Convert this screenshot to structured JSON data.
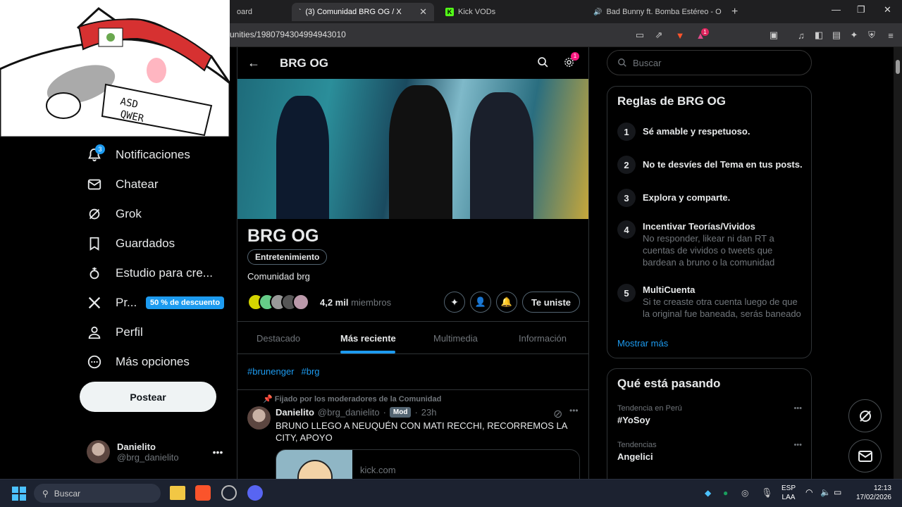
{
  "browser": {
    "tabs": [
      {
        "label": "oard",
        "active": false
      },
      {
        "label": "(3) Comunidad BRG OG / X",
        "active": true
      },
      {
        "label": "Kick VODs",
        "active": false
      },
      {
        "label": "Bad Bunny ft. Bomba Estéreo - O",
        "active": false
      }
    ],
    "url": "unities/1980794304994943010",
    "badge_count": "1"
  },
  "sidebar": {
    "notif_badge": "3",
    "items": [
      {
        "label": "Notificaciones",
        "icon": "bell-icon"
      },
      {
        "label": "Chatear",
        "icon": "mail-icon"
      },
      {
        "label": "Grok",
        "icon": "grok-icon"
      },
      {
        "label": "Guardados",
        "icon": "bookmark-icon"
      },
      {
        "label": "Estudio para cre...",
        "icon": "studio-icon"
      },
      {
        "label": "Pr...",
        "icon": "x-logo-icon"
      },
      {
        "label": "Perfil",
        "icon": "person-icon"
      },
      {
        "label": "Más opciones",
        "icon": "more-circle-icon"
      }
    ],
    "discount": "50 % de descuento",
    "post_label": "Postear",
    "user_name": "Danielito",
    "user_handle": "@brg_danielito"
  },
  "header": {
    "title": "BRG OG",
    "settings_badge": "1"
  },
  "community": {
    "name": "BRG OG",
    "category": "Entretenimiento",
    "description": "Comunidad brg",
    "members_count": "4,2 mil",
    "members_label": "miembros",
    "joined_label": "Te uniste"
  },
  "tabs": [
    "Destacado",
    "Más reciente",
    "Multimedia",
    "Información"
  ],
  "active_tab": 1,
  "hashtags": [
    "#brunenger",
    "#brg"
  ],
  "post": {
    "pinned_label": "Fijado por los moderadores de la Comunidad",
    "author": "Danielito",
    "handle": "@brg_danielito",
    "mod_badge": "Mod",
    "time": "23h",
    "text": "BRUNO LLEGO A NEUQUÉN CON MATI RECCHI, RECORREMOS LA CITY, APOYO",
    "link_domain": "kick.com"
  },
  "right": {
    "search_placeholder": "Buscar",
    "rules_title": "Reglas de BRG OG",
    "rules": [
      {
        "n": "1",
        "title": "Sé amable y respetuoso.",
        "desc": ""
      },
      {
        "n": "2",
        "title": "No te desvíes del Tema en tus posts.",
        "desc": ""
      },
      {
        "n": "3",
        "title": "Explora y comparte.",
        "desc": ""
      },
      {
        "n": "4",
        "title": "Incentivar Teorías/Vividos",
        "desc": "No responder, likear ni dan RT a cuentas de vividos o tweets que bardean a bruno o la comunidad"
      },
      {
        "n": "5",
        "title": "MultiCuenta",
        "desc": "Si te creaste otra cuenta luego de que la original fue baneada, serás baneado"
      }
    ],
    "show_more": "Mostrar más",
    "trends_title": "Qué está pasando",
    "trends": [
      {
        "context": "Tendencia en Perú",
        "name": "#YoSoy"
      },
      {
        "context": "Tendencias",
        "name": "Angelici"
      }
    ]
  },
  "taskbar": {
    "search_placeholder": "Buscar",
    "lang": "ESP",
    "lang2": "LAA",
    "time": "12:13",
    "date": "17/02/2026"
  }
}
